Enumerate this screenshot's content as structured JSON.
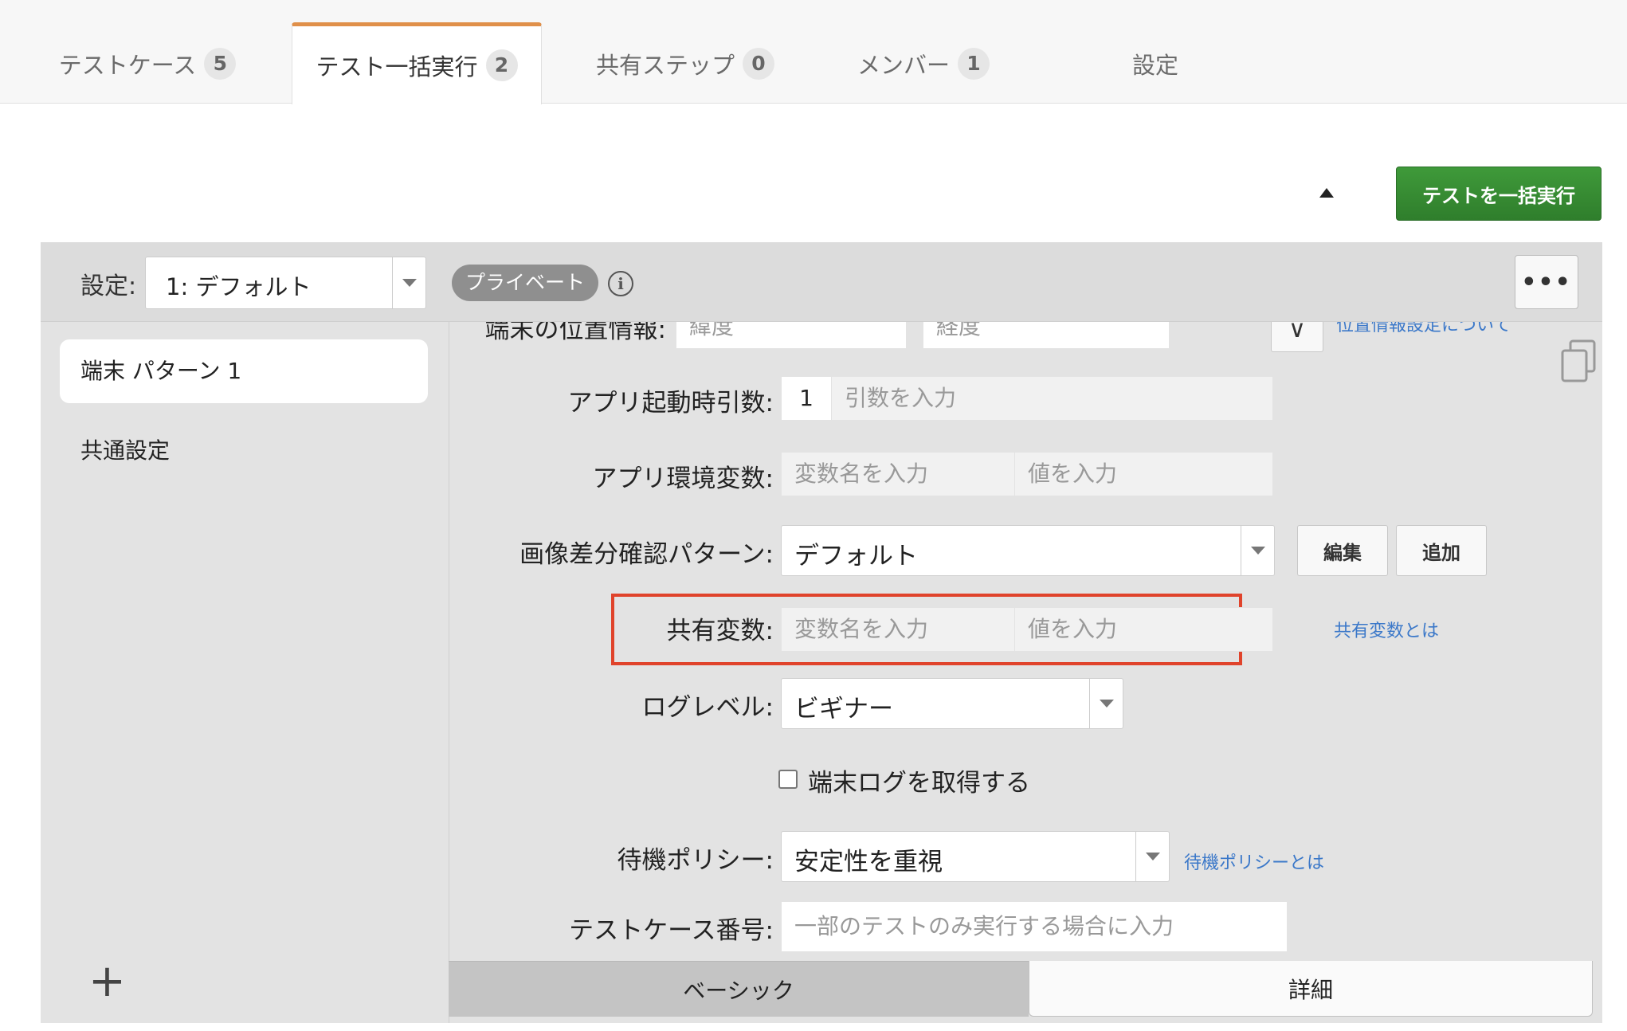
{
  "tabs": [
    {
      "label": "テストケース",
      "count": "5"
    },
    {
      "label": "テスト一括実行",
      "count": "2"
    },
    {
      "label": "共有ステップ",
      "count": "0"
    },
    {
      "label": "メンバー",
      "count": "1"
    },
    {
      "label": "設定",
      "count": ""
    }
  ],
  "toolbar": {
    "run_all_label": "テストを一括実行"
  },
  "panel": {
    "settings_label": "設定:",
    "settings_value": "1: デフォルト",
    "visibility_badge": "プライベート",
    "info_icon": "i",
    "more_icon": "•••"
  },
  "sidebar": {
    "items": [
      "端末 パターン 1",
      "共通設定"
    ],
    "add_icon": "+"
  },
  "form": {
    "location": {
      "label": "端末の位置情報:",
      "lat_placeholder": "緯度",
      "lng_placeholder": "経度",
      "link": "位置情報設定について"
    },
    "launch_args": {
      "label": "アプリ起動時引数:",
      "index": "1",
      "placeholder": "引数を入力"
    },
    "env_vars": {
      "label": "アプリ環境変数:",
      "name_placeholder": "変数名を入力",
      "value_placeholder": "値を入力"
    },
    "image_diff": {
      "label": "画像差分確認パターン:",
      "value": "デフォルト",
      "edit_label": "編集",
      "add_label": "追加"
    },
    "shared_vars": {
      "label": "共有変数:",
      "name_placeholder": "変数名を入力",
      "value_placeholder": "値を入力",
      "link": "共有変数とは"
    },
    "log_level": {
      "label": "ログレベル:",
      "value": "ビギナー"
    },
    "device_log": {
      "label": "端末ログを取得する",
      "checked": false
    },
    "wait_policy": {
      "label": "待機ポリシー:",
      "value": "安定性を重視",
      "link": "待機ポリシーとは"
    },
    "test_case_no": {
      "label": "テストケース番号:",
      "placeholder": "一部のテストのみ実行する場合に入力"
    }
  },
  "bottom_tabs": {
    "basic": "ベーシック",
    "detail": "詳細"
  },
  "colors": {
    "accent": "#e0904a",
    "run_button": "#2f7e2c",
    "highlight": "#e0432b",
    "link": "#3b78c9"
  }
}
